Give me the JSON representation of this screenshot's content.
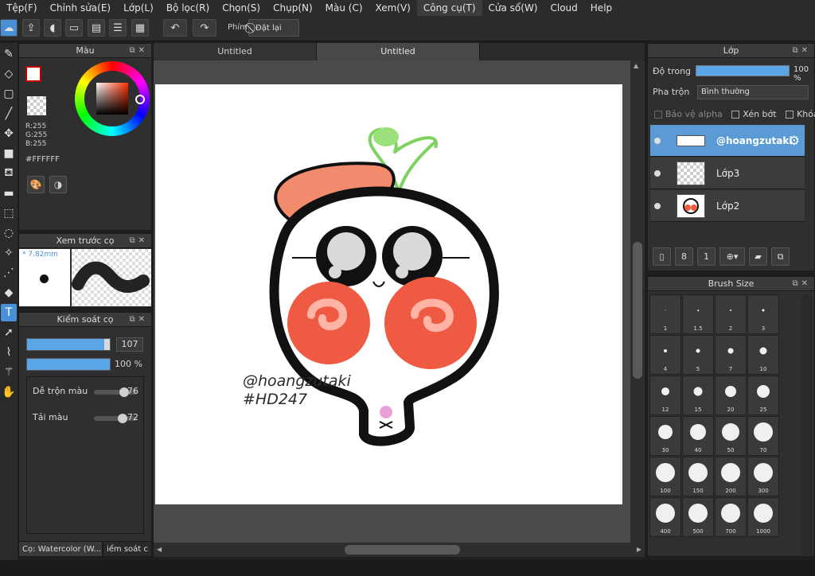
{
  "menu": [
    "Tệp(F)",
    "Chỉnh sửa(E)",
    "Lớp(L)",
    "Bộ lọc(R)",
    "Chọn(S)",
    "Chụp(N)",
    "Màu (C)",
    "Xem(V)",
    "Công cụ(T)",
    "Cửa sổ(W)",
    "Cloud",
    "Help"
  ],
  "toolbar": {
    "phim_label": "Phím",
    "reset_label": "Đặt lại"
  },
  "color_panel": {
    "title": "Màu",
    "r": "R:255",
    "g": "G:255",
    "b": "B:255",
    "hex": "#FFFFFF",
    "fg_color": "#ffffff",
    "accent_border": "#c00000"
  },
  "preview_panel": {
    "title": "Xem trước cọ",
    "size": "* 7.82mm"
  },
  "control_panel": {
    "title": "Kiểm soát cọ",
    "size_value": "107",
    "opacity_value": "100 %",
    "size_fraction": 0.93,
    "opacity_fraction": 1.0,
    "blend_label": "Dễ trộn màu",
    "blend_value": "76",
    "blend_fraction": 0.76,
    "dilute_label": "Tải màu",
    "dilute_value": "72",
    "dilute_fraction": 0.72
  },
  "bottom_tabs": [
    "Cọ: Watercolor (W...",
    "iểm soát c"
  ],
  "doc_tabs": [
    "Untitled",
    "Untitled"
  ],
  "artwork": {
    "signature": "@hoangzutaki",
    "tag": "#HD247"
  },
  "layer_panel": {
    "title": "Lớp",
    "opacity_label": "Độ trong",
    "opacity_value": "100 %",
    "blend_label": "Pha trộn",
    "blend_value": "Bình thường",
    "protect_alpha": "Bảo vệ alpha",
    "clip": "Xén bớt",
    "lock": "Khóa",
    "layers": [
      {
        "name": "@hoangzutaki",
        "selected": true
      },
      {
        "name": "Lớp3",
        "selected": false
      },
      {
        "name": "Lớp2",
        "selected": false
      }
    ]
  },
  "brush_panel": {
    "title": "Brush Size",
    "sizes": [
      "1",
      "1.5",
      "2",
      "3",
      "4",
      "5",
      "7",
      "10",
      "12",
      "15",
      "20",
      "25",
      "30",
      "40",
      "50",
      "70",
      "100",
      "150",
      "200",
      "300",
      "400",
      "500",
      "700",
      "1000"
    ]
  },
  "colors": {
    "accent": "#5b9bd5",
    "slider_fill": "#5aa6e6",
    "panel_bg": "#2f2f2f"
  }
}
